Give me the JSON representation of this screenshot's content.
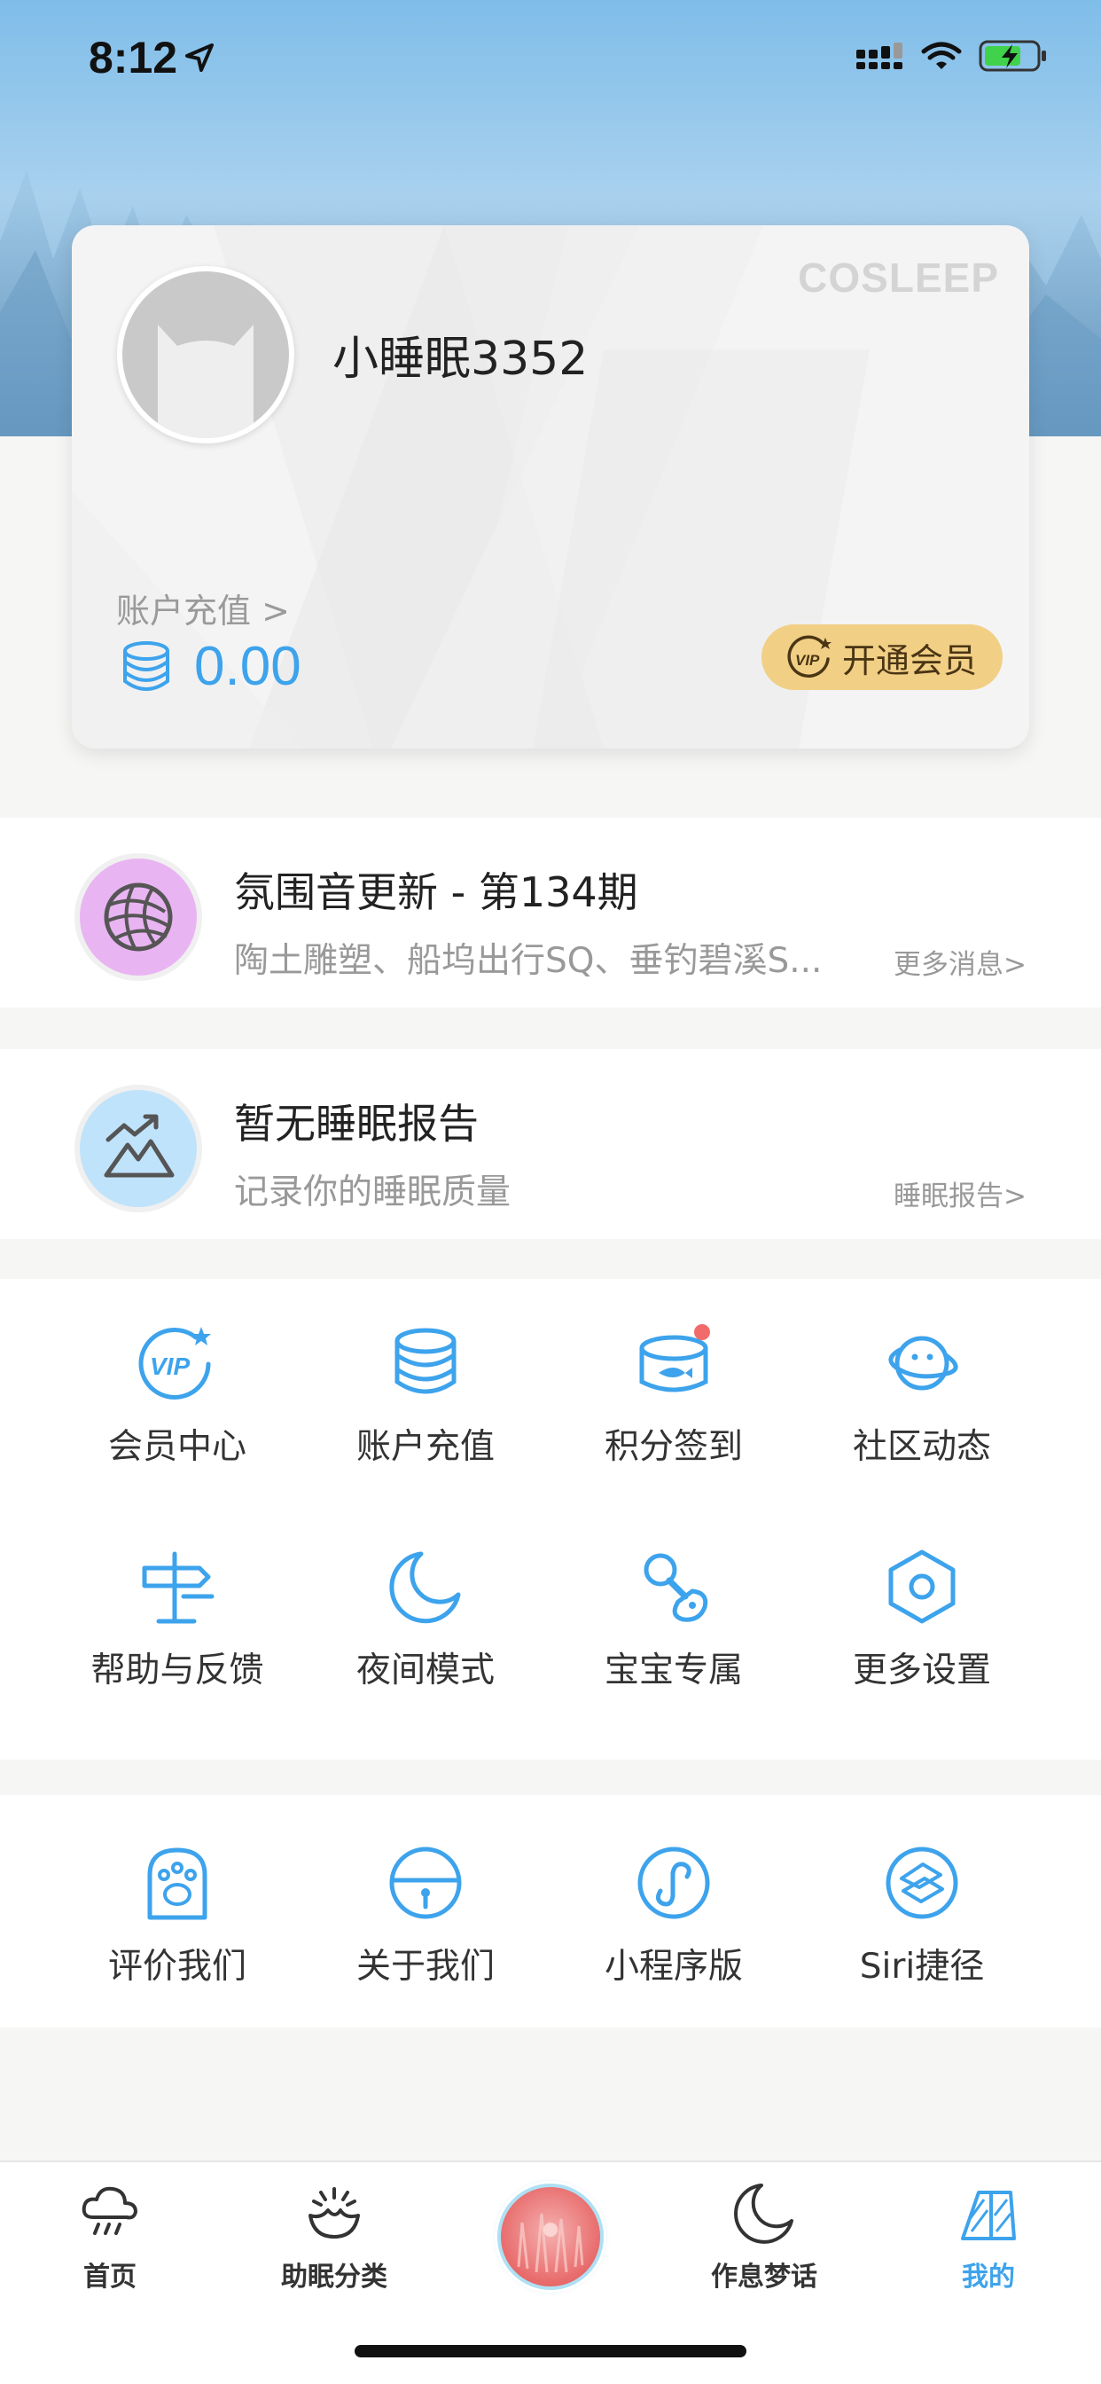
{
  "status_bar": {
    "time": "8:12"
  },
  "profile": {
    "brand": "COSLEEP",
    "username": "小睡眠3352",
    "recharge_link": "账户充值 >",
    "balance": "0.00",
    "vip_button": "开通会员"
  },
  "news_row": {
    "title": "氛围音更新 - 第134期",
    "subtitle": "陶土雕塑、船坞出行SQ、垂钓碧溪S...",
    "more": "更多消息>"
  },
  "report_row": {
    "title": "暂无睡眠报告",
    "subtitle": "记录你的睡眠质量",
    "more": "睡眠报告>"
  },
  "grid_main": [
    {
      "label": "会员中心",
      "icon": "vip-icon"
    },
    {
      "label": "账户充值",
      "icon": "coins-icon"
    },
    {
      "label": "积分签到",
      "icon": "can-icon"
    },
    {
      "label": "社区动态",
      "icon": "planet-icon"
    },
    {
      "label": "帮助与反馈",
      "icon": "signpost-icon"
    },
    {
      "label": "夜间模式",
      "icon": "moon-icon"
    },
    {
      "label": "宝宝专属",
      "icon": "pacifier-icon"
    },
    {
      "label": "更多设置",
      "icon": "hexagon-settings-icon"
    }
  ],
  "grid_extra": [
    {
      "label": "评价我们",
      "icon": "paw-icon"
    },
    {
      "label": "关于我们",
      "icon": "bell-icon"
    },
    {
      "label": "小程序版",
      "icon": "mini-program-icon"
    },
    {
      "label": "Siri捷径",
      "icon": "shortcut-icon"
    }
  ],
  "tabbar": [
    {
      "label": "首页",
      "icon": "rain-cloud-icon"
    },
    {
      "label": "助眠分类",
      "icon": "bowl-icon"
    },
    {
      "label": "",
      "icon": "player-disc-icon"
    },
    {
      "label": "作息梦话",
      "icon": "moon-icon"
    },
    {
      "label": "我的",
      "icon": "profile-tab-icon",
      "active": true
    }
  ],
  "colors": {
    "accent": "#3da3ec",
    "vip_gold": "#f1cf85",
    "news_circle": "#e9b4f2",
    "report_circle": "#bfe3fb"
  }
}
